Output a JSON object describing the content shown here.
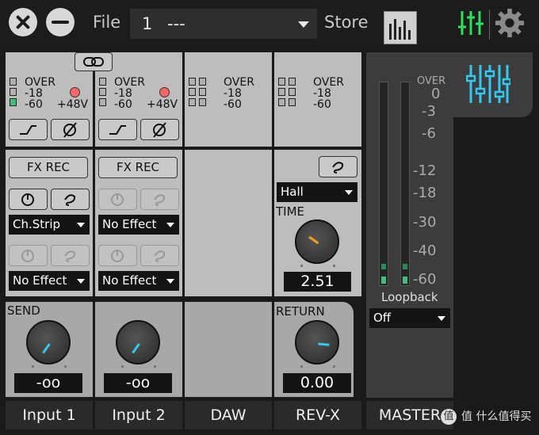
{
  "topbar": {
    "file_label": "File",
    "scene_number": "1",
    "scene_name": "---",
    "store_label": "Store",
    "accent_green": "#2de05a"
  },
  "meter_labels": {
    "over": "OVER",
    "m18": "-18",
    "m60": "-60",
    "phantom": "+48V"
  },
  "channels": {
    "input1": {
      "name": "Input 1",
      "fx_rec": "FX REC",
      "effect1": "Ch.Strip",
      "effect2": "No Effect",
      "send_label": "SEND",
      "send_value": "-oo"
    },
    "input2": {
      "name": "Input 2",
      "fx_rec": "FX REC",
      "effect1": "No Effect",
      "effect2": "No Effect",
      "send_value": "-oo"
    },
    "daw": {
      "name": "DAW"
    },
    "revx": {
      "name": "REV-X",
      "type": "Hall",
      "time_label": "TIME",
      "time_value": "2.51",
      "return_label": "RETURN",
      "return_value": "0.00"
    },
    "master": {
      "name": "MASTER",
      "scale": [
        "OVER",
        "0",
        "-3",
        "-6",
        "-12",
        "-18",
        "-30",
        "-40",
        "-60"
      ],
      "loopback_label": "Loopback",
      "loopback_value": "Off",
      "accent_cyan": "#32c8f0"
    }
  },
  "watermark": "值 什么值得买"
}
